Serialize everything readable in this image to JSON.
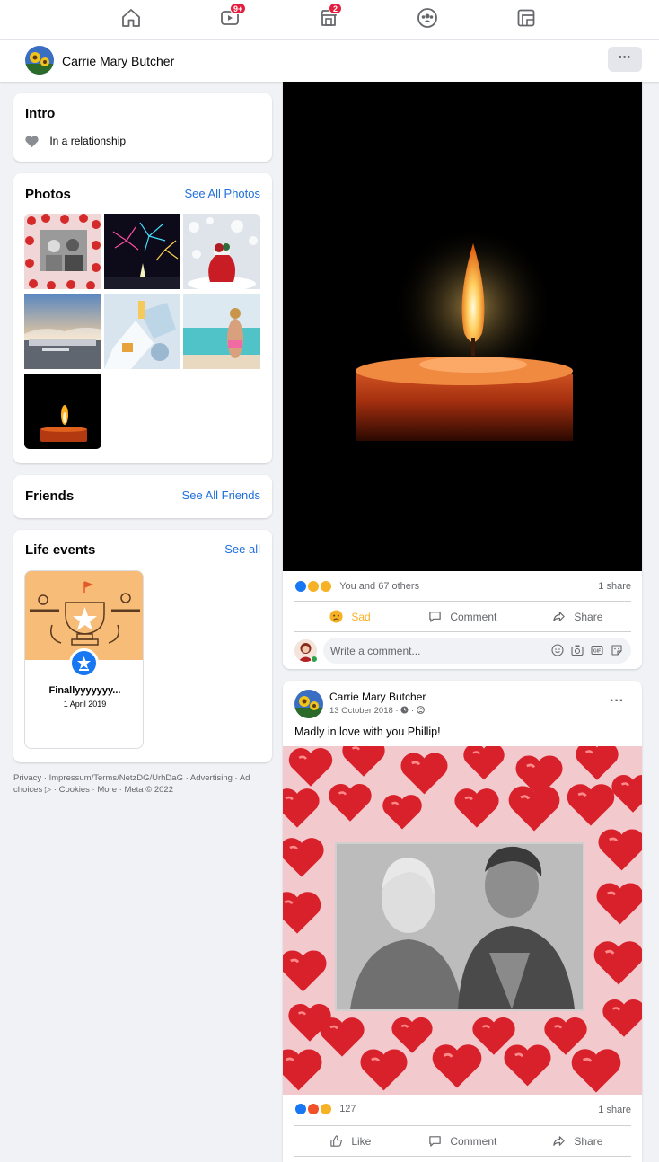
{
  "nav": {
    "items": [
      {
        "name": "home",
        "badge": ""
      },
      {
        "name": "watch",
        "badge": "9+"
      },
      {
        "name": "marketplace",
        "badge": "2"
      },
      {
        "name": "groups",
        "badge": ""
      },
      {
        "name": "gaming",
        "badge": ""
      }
    ]
  },
  "profile": {
    "name": "Carrie Mary Butcher",
    "more_label": "···"
  },
  "intro": {
    "title": "Intro",
    "relationship": "In a relationship"
  },
  "photos": {
    "title": "Photos",
    "see_all": "See All Photos"
  },
  "friends": {
    "title": "Friends",
    "see_all": "See All Friends"
  },
  "life_events": {
    "title": "Life events",
    "see_all": "See all",
    "event_title": "Finallyyyyyyy...",
    "event_date": "1 April 2019"
  },
  "footer": {
    "text": "Privacy · Impressum/Terms/NetzDG/UrhDaG · Advertising · Ad choices ▷ · Cookies · More · Meta © 2022"
  },
  "post1": {
    "reactions_text": "You and 67 others",
    "shares": "1 share",
    "reaction_label": "Sad",
    "comment_label": "Comment",
    "share_label": "Share",
    "comment_placeholder": "Write a comment..."
  },
  "post2": {
    "author": "Carrie Mary Butcher",
    "date": "13 October 2018 ·",
    "text": "Madly in love with you Phillip!",
    "reactions_count": "127",
    "shares": "1 share",
    "like_label": "Like",
    "comment_label": "Comment",
    "share_label": "Share",
    "more_label": "···"
  },
  "colors": {
    "accent": "#1877f2",
    "link": "#216fdb",
    "sad": "#f7b125",
    "badge": "#e41e3f"
  }
}
